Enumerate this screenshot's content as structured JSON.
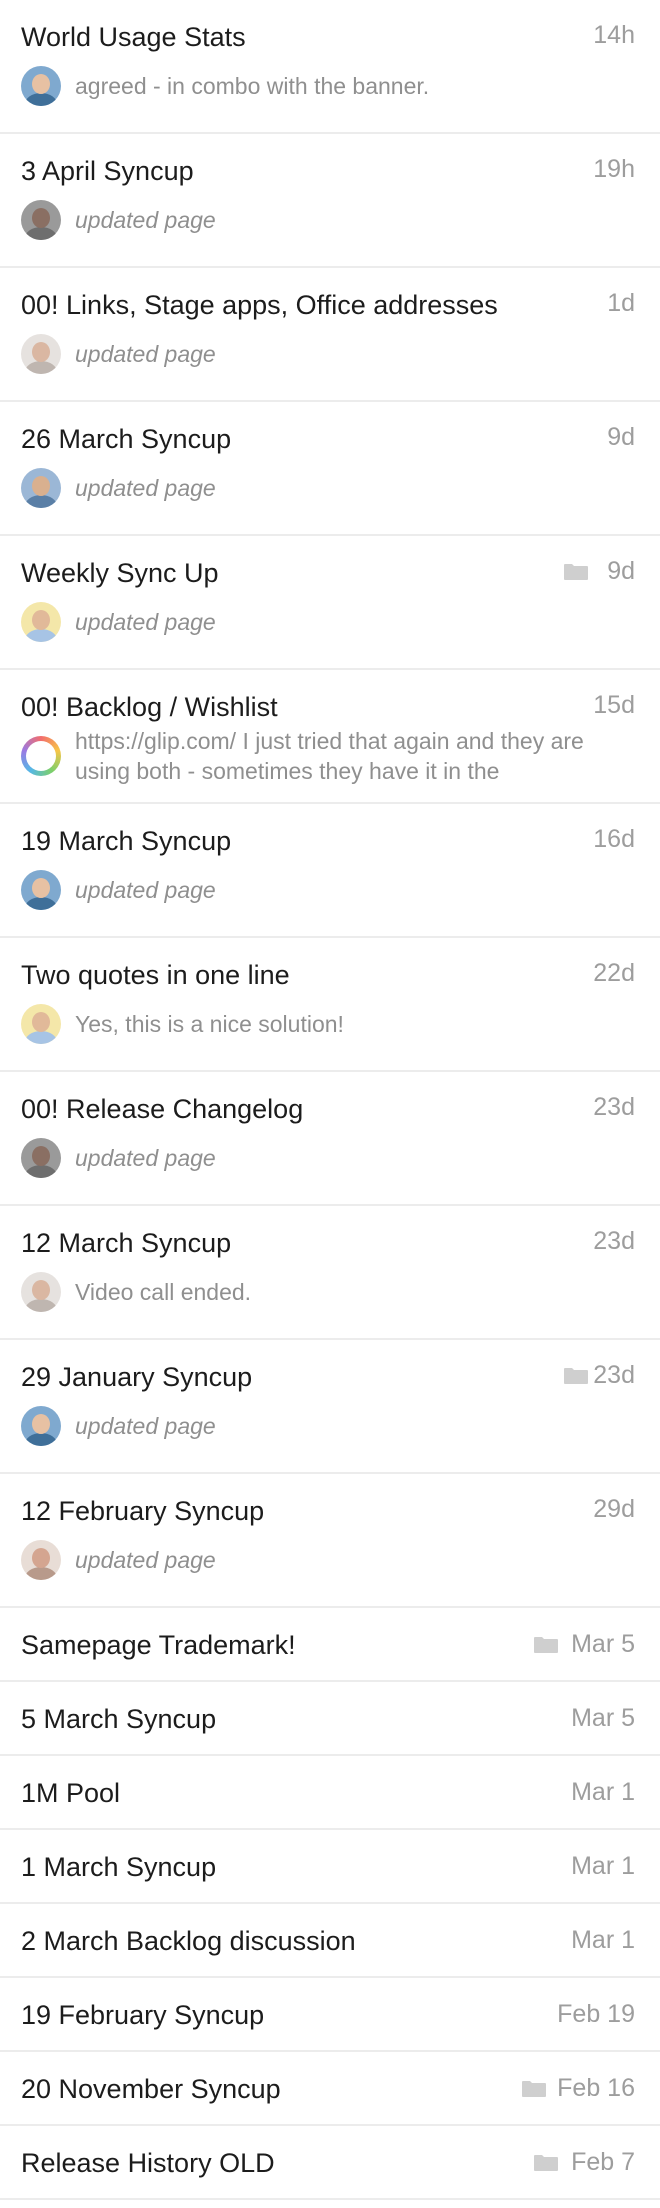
{
  "conversations": [
    {
      "title": "World Usage Stats",
      "time": "14h",
      "folder": false,
      "preview": "agreed - in combo with the banner.",
      "preview_style": "normal",
      "avatar_style": "blue-man"
    },
    {
      "title": "3 April Syncup",
      "time": "19h",
      "folder": false,
      "preview": "updated page",
      "preview_style": "italic",
      "avatar_style": "grey-woman"
    },
    {
      "title": "00! Links, Stage apps, Office addresses",
      "time": "1d",
      "folder": false,
      "preview": "updated page",
      "preview_style": "italic",
      "avatar_style": "bald-man"
    },
    {
      "title": "26 March Syncup",
      "time": "9d",
      "folder": false,
      "preview": "updated page",
      "preview_style": "italic",
      "avatar_style": "blue-man-2"
    },
    {
      "title": "Weekly Sync Up",
      "time": "9d",
      "folder": true,
      "preview": "updated page",
      "preview_style": "italic",
      "avatar_style": "colorful-man"
    },
    {
      "title": "00! Backlog / Wishlist",
      "time": "15d",
      "folder": false,
      "preview": "https://glip.com/ I just tried that again and they are using both - sometimes they have it in the",
      "preview_style": "multi",
      "avatar_style": "ring"
    },
    {
      "title": "19 March Syncup",
      "time": "16d",
      "folder": false,
      "preview": "updated page",
      "preview_style": "italic",
      "avatar_style": "blue-man"
    },
    {
      "title": "Two quotes in one line",
      "time": "22d",
      "folder": false,
      "preview": "Yes, this is a nice solution!",
      "preview_style": "normal",
      "avatar_style": "colorful-man"
    },
    {
      "title": "00! Release Changelog",
      "time": "23d",
      "folder": false,
      "preview": "updated page",
      "preview_style": "italic",
      "avatar_style": "grey-woman"
    },
    {
      "title": "12 March Syncup",
      "time": "23d",
      "folder": false,
      "preview": "Video call ended.",
      "preview_style": "normal",
      "avatar_style": "bald-man"
    },
    {
      "title": "29 January Syncup",
      "time": "23d",
      "folder": true,
      "preview": "updated page",
      "preview_style": "italic",
      "avatar_style": "blue-man"
    },
    {
      "title": "12 February Syncup",
      "time": "29d",
      "folder": false,
      "preview": "updated page",
      "preview_style": "italic",
      "avatar_style": "bald-man-2"
    },
    {
      "title": "Samepage Trademark!",
      "time": "Mar 5",
      "folder": true
    },
    {
      "title": "5 March Syncup",
      "time": "Mar 5",
      "folder": false
    },
    {
      "title": "1M Pool",
      "time": "Mar 1",
      "folder": false
    },
    {
      "title": "1 March Syncup",
      "time": "Mar 1",
      "folder": false
    },
    {
      "title": "2 March Backlog discussion",
      "time": "Mar 1",
      "folder": false
    },
    {
      "title": "19 February Syncup",
      "time": "Feb 19",
      "folder": false
    },
    {
      "title": "20 November Syncup",
      "time": "Feb 16",
      "folder": true
    },
    {
      "title": "Release History OLD",
      "time": "Feb 7",
      "folder": true
    }
  ],
  "colors": {
    "title": "#1c1c1c",
    "meta": "#9d9d9d",
    "preview": "#8f8f8f",
    "divider": "#ececec",
    "folder_icon": "#cfcfcf"
  },
  "icons": {
    "folder": "folder-icon",
    "avatar": "avatar-icon"
  }
}
